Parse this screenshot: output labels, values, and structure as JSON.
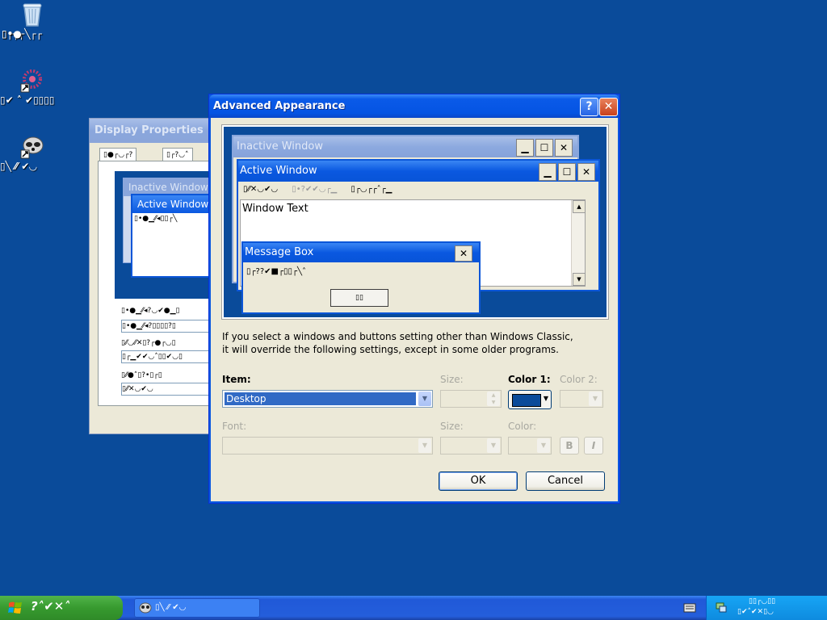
{
  "desktop": {
    "icons": [
      {
        "name": "recycle-bin",
        "label_line1": "▯┌┐┌╲┌┌",
        "label_line2": "▯•●"
      },
      {
        "name": "shortcut-flower",
        "label": "▯✔ ˄ ✔▯▯▯▯"
      },
      {
        "name": "shortcut-raccoon",
        "label": "▯╲ ⁄⁄ ✔◡"
      }
    ]
  },
  "display_properties": {
    "title": "Display Properties",
    "tabs": [
      "▯●┌◡┌?",
      "▯┌?◡˄"
    ],
    "preview": {
      "inactive_title": "Inactive Window",
      "active_title": "Active Window",
      "menu_text": "▯•●▁⁄⁄◂▯▯┌╲"
    },
    "rows": [
      "▯•●▁⁄⁄◂?◡✔●▁▯",
      "▯•●▁⁄⁄◂?▯▯▯▯?▯",
      "▯⁄⁄◡⁄⁄✕▯?┌●┌◡▯",
      "▯┌▁✔✔◡˄▯▯✔◡▯",
      "▯⁄⁄●˄▯?•▯┌▯",
      "▯⁄⁄✕◡✔◡"
    ]
  },
  "dialog": {
    "title": "Advanced Appearance",
    "help_glyph": "?",
    "close_glyph": "✕",
    "preview": {
      "inactive_title": "Inactive Window",
      "active_title": "Active Window",
      "menu_items": [
        {
          "label": "▯⁄⁄✕◡✔◡",
          "enabled": true
        },
        {
          "label": "▯•?✔✔◡┌▁",
          "enabled": false
        },
        {
          "label": "▯┌◡┌┌˄┌▁",
          "enabled": true
        }
      ],
      "window_text": "Window Text",
      "message_box": {
        "title": "Message Box",
        "text": "▯┌??✔■┌▯▯┌╲˄",
        "ok_label": "▯▯"
      },
      "minimize_glyph": "▁",
      "maximize_glyph": "☐",
      "close_glyph": "✕"
    },
    "info_line1": "If you select a windows and buttons setting other than Windows Classic,",
    "info_line2": "it will override the following settings, except in some older programs.",
    "item_label": "Item:",
    "item_value": "Desktop",
    "size_label": "Size:",
    "color1_label": "Color 1:",
    "color2_label": "Color 2:",
    "font_label": "Font:",
    "font_size_label": "Size:",
    "font_color_label": "Color:",
    "bold_label": "B",
    "italic_label": "I",
    "ok_label": "OK",
    "cancel_label": "Cancel",
    "color1_value": "#0a4b9a"
  },
  "taskbar": {
    "start_label": "?˄✔✕˄",
    "task_label": "▯╲ ⁄⁄ ✔◡",
    "tray_line1": "▯▯┌◡▯▯",
    "tray_line2": "▯✔˄✔✕▯◡"
  },
  "colors": {
    "desktop": "#0a4b9a",
    "title_active": "#0a58e0",
    "title_inactive": "#8aa6dc",
    "selection": "#316ac5",
    "start_green": "#379a2f"
  }
}
